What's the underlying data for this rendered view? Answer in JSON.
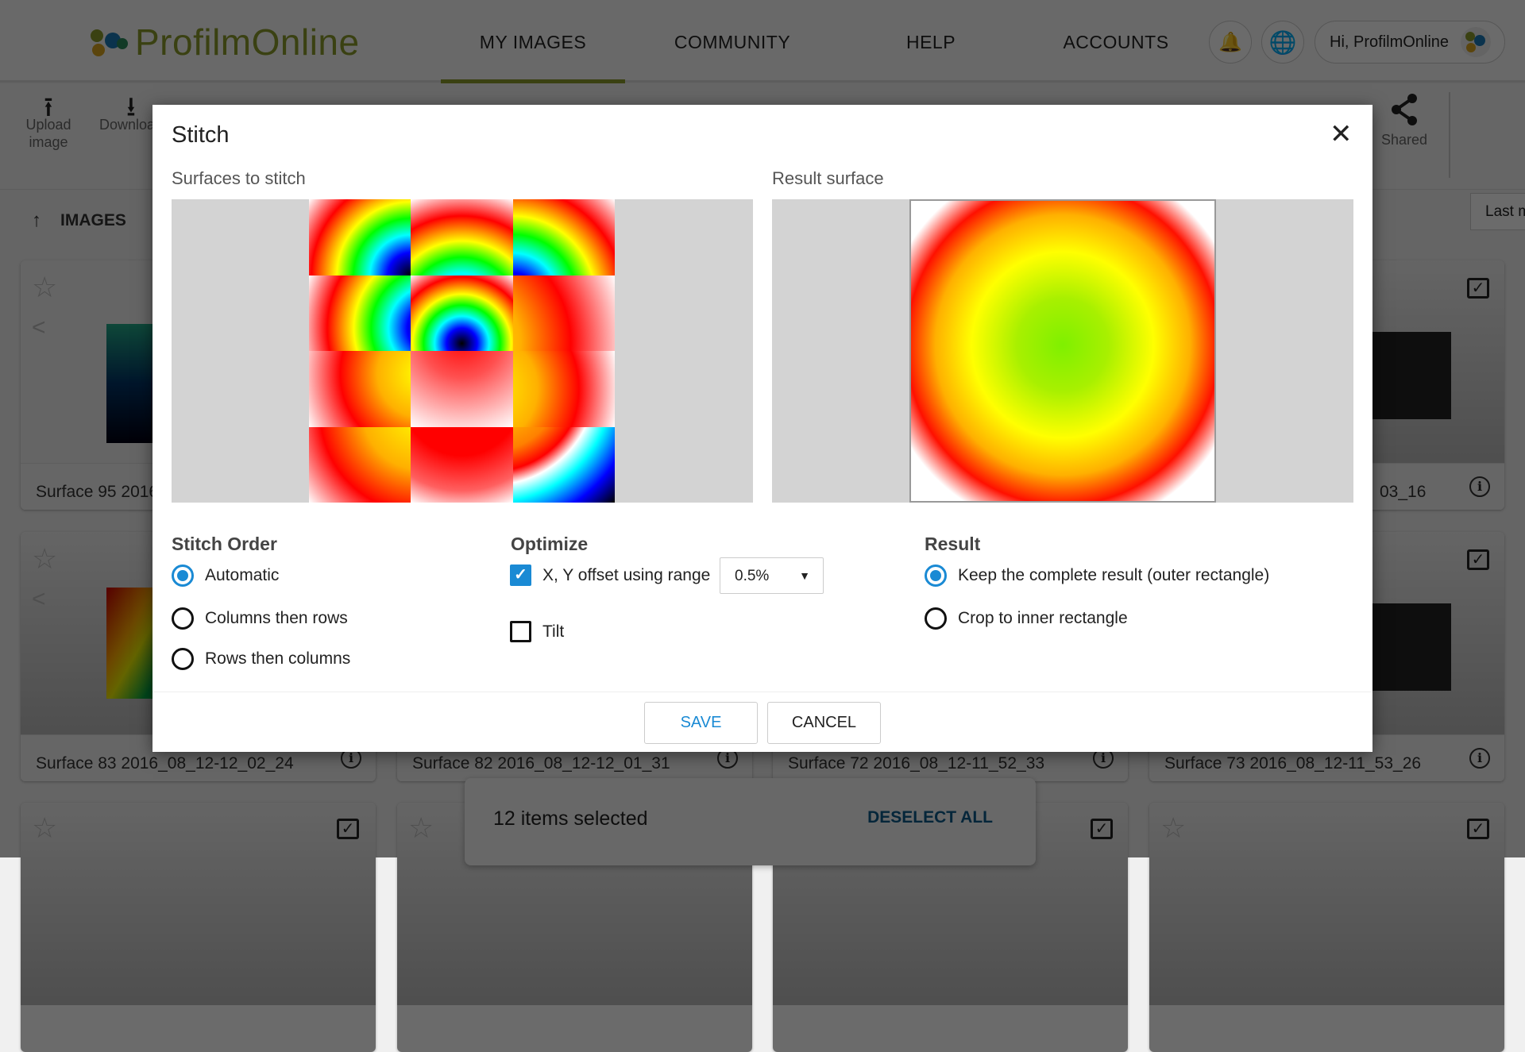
{
  "header": {
    "logo": "ProfilmOnline",
    "nav": [
      "MY IMAGES",
      "COMMUNITY",
      "HELP",
      "ACCOUNTS"
    ],
    "user": "Hi, ProfilmOnline",
    "icons": [
      "bell-icon",
      "globe-icon"
    ]
  },
  "toolbar": {
    "upload": "Upload image",
    "download": "Download",
    "shared": "Shared",
    "sort": "Last m"
  },
  "breadcrumb": {
    "label": "IMAGES"
  },
  "cards": [
    {
      "title": "Surface 95 2016"
    },
    {
      "title": ""
    },
    {
      "title": ""
    },
    {
      "title": "03_16"
    },
    {
      "title": "Surface 83 2016_08_12-12_02_24"
    },
    {
      "title": "Surface 82 2016_08_12-12_01_31"
    },
    {
      "title": "Surface 72 2016_08_12-11_52_33"
    },
    {
      "title": "Surface 73 2016_08_12-11_53_26"
    }
  ],
  "snackbar": {
    "text": "12 items selected",
    "action": "DESELECT ALL"
  },
  "dialog": {
    "title": "Stitch",
    "surfaces_label": "Surfaces to stitch",
    "result_label": "Result surface",
    "stitch_order": {
      "heading": "Stitch Order",
      "options": [
        "Automatic",
        "Columns then rows",
        "Rows then columns"
      ],
      "selected": "Automatic"
    },
    "optimize": {
      "heading": "Optimize",
      "xy_label": "X, Y offset using range",
      "xy_checked": true,
      "range": "0.5%",
      "tilt_label": "Tilt",
      "tilt_checked": false
    },
    "result": {
      "heading": "Result",
      "options": [
        "Keep the complete result (outer rectangle)",
        "Crop to inner rectangle"
      ],
      "selected": "Keep the complete result (outer rectangle)"
    },
    "save": "SAVE",
    "cancel": "CANCEL"
  },
  "colors": {
    "accent": "#1a8ad4",
    "brand": "#8a9a2a"
  }
}
